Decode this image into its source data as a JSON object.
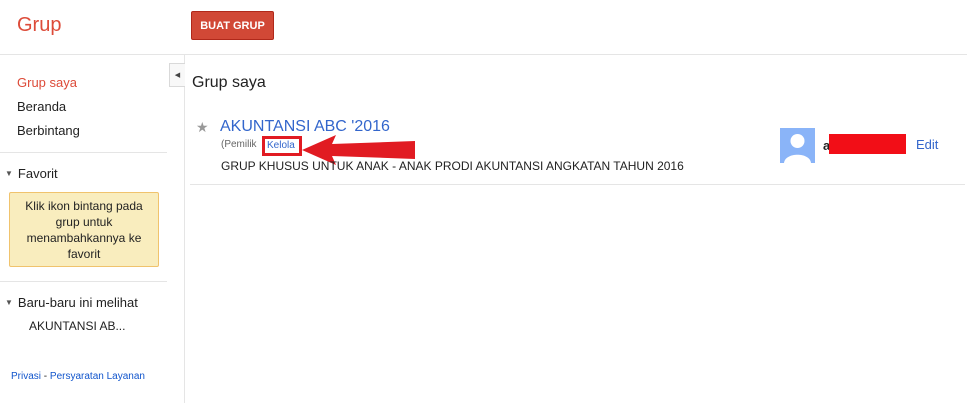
{
  "header": {
    "brand": "Grup",
    "create_button": "BUAT GRUP"
  },
  "sidebar": {
    "items": [
      {
        "label": "Grup saya",
        "active": true
      },
      {
        "label": "Beranda"
      },
      {
        "label": "Berbintang"
      }
    ],
    "favorit": {
      "title": "Favorit",
      "hint": "Klik ikon bintang pada grup untuk menambahkannya ke favorit"
    },
    "recent": {
      "title": "Baru-baru ini melihat",
      "items": [
        "AKUNTANSI AB..."
      ]
    },
    "footer": {
      "privacy": "Privasi",
      "separator": " - ",
      "terms": "Persyaratan Layanan"
    }
  },
  "main": {
    "title": "Grup saya",
    "groups": [
      {
        "name": "AKUNTANSI ABC '2016",
        "role_prefix": "(Pemilik",
        "manage_label": "Kelola",
        "description": "GRUP KHUSUS UNTUK ANAK - ANAK PRODI AKUNTANSI ANGKATAN TAHUN 2016",
        "owner_initial": "a",
        "edit_label": "Edit"
      }
    ]
  },
  "colors": {
    "accent": "#dd4b39",
    "button": "#d14836",
    "link": "#3366cc",
    "annotation_red": "#e11b22",
    "favorit_bg": "#f9edbe"
  },
  "icons": [
    "star-icon",
    "collapse-arrow-icon",
    "triangle-down-icon",
    "avatar-icon",
    "red-arrow-annotation"
  ]
}
